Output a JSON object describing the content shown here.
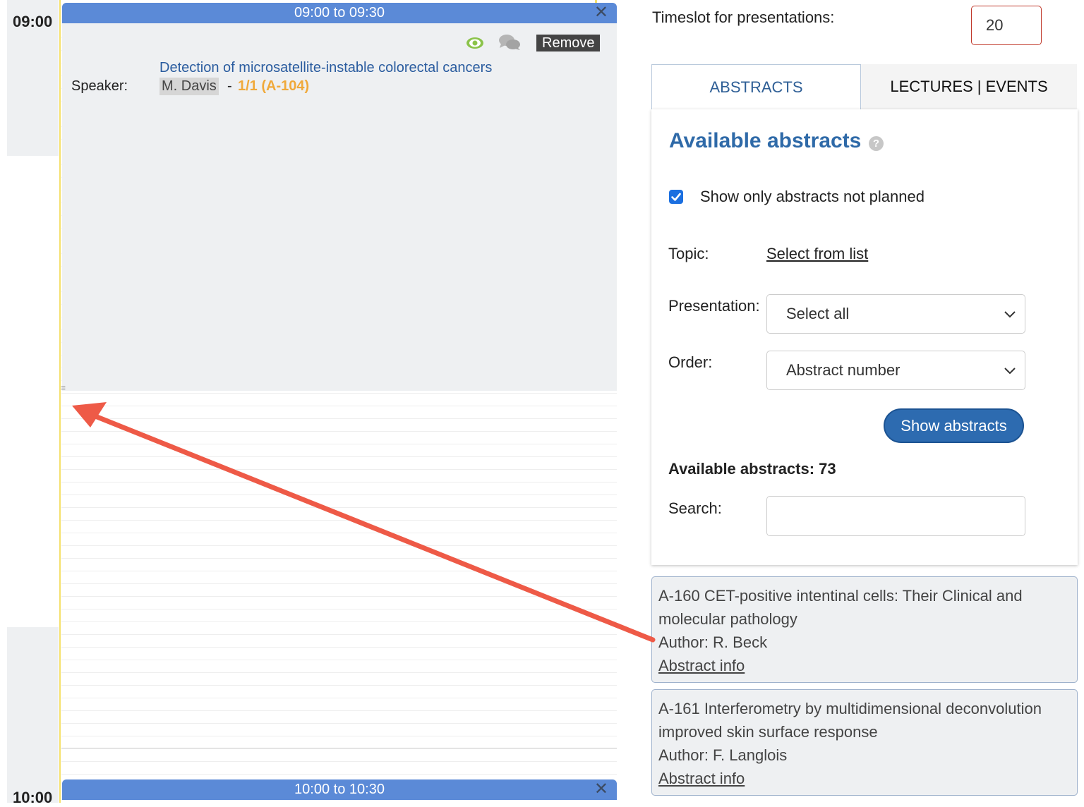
{
  "schedule": {
    "times": [
      "09:00",
      "10:00"
    ],
    "slots": [
      {
        "label": "09:00 to 09:30",
        "close": "✕"
      },
      {
        "label": "10:00 to 10:30",
        "close": "✕"
      }
    ],
    "handle": "=",
    "presentation": {
      "title": "Detection of microsatellite-instable colorectal cancers",
      "speaker_label": "Speaker:",
      "speaker_name": "M. Davis",
      "separator": "-",
      "number": "1/1 (A-104)",
      "remove_label": "Remove",
      "icons": [
        "eye-icon",
        "comments-icon"
      ]
    }
  },
  "settings": {
    "timeslot_label": "Timeslot for presentations:",
    "timeslot_value": "20"
  },
  "tabs": [
    {
      "label": "ABSTRACTS",
      "active": true
    },
    {
      "label": "LECTURES | EVENTS",
      "active": false
    }
  ],
  "abstracts_panel": {
    "title": "Available abstracts",
    "help": "?",
    "show_not_planned_label": "Show only abstracts not planned",
    "show_not_planned_checked": true,
    "topic_label": "Topic:",
    "topic_link": "Select from list",
    "presentation_label": "Presentation:",
    "presentation_value": "Select all",
    "order_label": "Order:",
    "order_value": "Abstract number",
    "show_button": "Show abstracts",
    "count_label": "Available abstracts: 73",
    "search_label": "Search:",
    "search_value": ""
  },
  "abstracts": [
    {
      "title": "A-160 CET-positive intentinal cells: Their Clinical and molecular pathology",
      "author": "Author: R. Beck",
      "link": "Abstract info"
    },
    {
      "title": "A-161 Interferometry by multidimensional deconvolution improved skin surface response",
      "author": "Author: F. Langlois",
      "link": "Abstract info"
    }
  ],
  "colors": {
    "slot_header": "#5b8ad7",
    "accent_blue": "#2f6aa8",
    "arrow": "#ee5a47",
    "speaker_number": "#f0a93a"
  }
}
